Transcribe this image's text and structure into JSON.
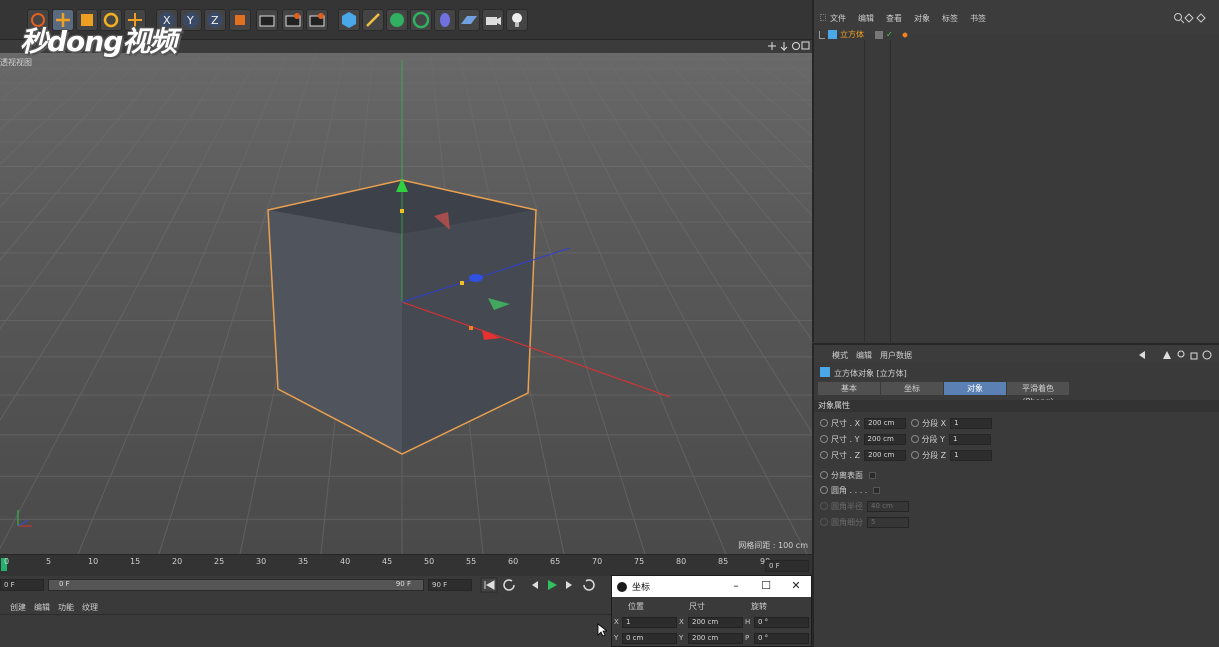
{
  "object_manager": {
    "menu": [
      "文件",
      "编辑",
      "查看",
      "对象",
      "标签",
      "书签"
    ],
    "object_name": "立方体"
  },
  "viewport": {
    "label": "透视视图",
    "grid_spacing": "网格间距 : 100 cm"
  },
  "attribute_manager": {
    "menu": [
      "模式",
      "编辑",
      "用户数据"
    ],
    "title": "立方体对象 [立方体]",
    "tabs": [
      "基本",
      "坐标",
      "对象",
      "平滑着色(Phong)"
    ],
    "active_tab": "对象",
    "section": "对象属性",
    "size_x_label": "尺寸 . X",
    "size_x": "200 cm",
    "size_y_label": "尺寸 . Y",
    "size_y": "200 cm",
    "size_z_label": "尺寸 . Z",
    "size_z": "200 cm",
    "seg_x_label": "分段 X",
    "seg_x": "1",
    "seg_y_label": "分段 Y",
    "seg_y": "1",
    "seg_z_label": "分段 Z",
    "seg_z": "1",
    "separate_surfaces": "分离表面",
    "fillet": "圆角 . . . .",
    "fillet_radius_label": "圆角半径",
    "fillet_radius": "40 cm",
    "fillet_subdiv_label": "圆角细分",
    "fillet_subdiv": "5"
  },
  "timeline": {
    "ticks": [
      "0",
      "5",
      "10",
      "15",
      "20",
      "25",
      "30",
      "35",
      "40",
      "45",
      "50",
      "55",
      "60",
      "65",
      "70",
      "75",
      "80",
      "85",
      "90"
    ],
    "frame_field": "0 F",
    "start_field": "0 F",
    "range_start": "0 F",
    "range_end": "90 F",
    "end_field": "90 F"
  },
  "bottom_menu": [
    "创建",
    "编辑",
    "功能",
    "纹理"
  ],
  "coord_dialog": {
    "title": "坐标",
    "headers": [
      "位置",
      "尺寸",
      "旋转"
    ],
    "row1": {
      "axis": "X",
      "pos": "1",
      "size_axis": "X",
      "size": "200 cm",
      "rot_axis": "H",
      "rot": "0 °"
    },
    "row2": {
      "axis": "Y",
      "pos": "0 cm",
      "size_axis": "Y",
      "size": "200 cm",
      "rot_axis": "P",
      "rot": "0 °"
    }
  },
  "watermark": "秒dong视频",
  "colors": {
    "accent": "#5a80b4",
    "selection_orange": "#f0a020",
    "cube_face": "#4a4f58",
    "axis_x": "#e83030",
    "axis_y": "#20c040",
    "axis_z": "#3050e0"
  }
}
